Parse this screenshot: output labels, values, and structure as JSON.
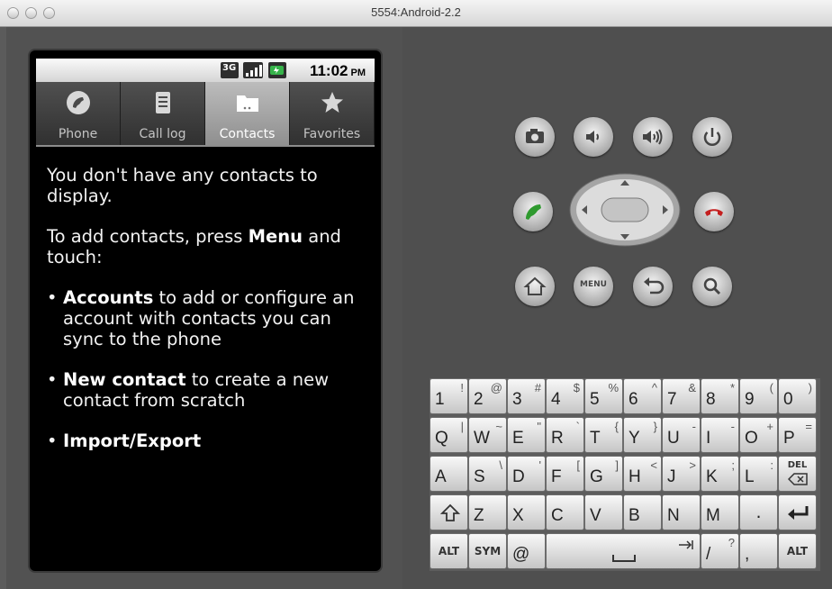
{
  "window": {
    "title": "5554:Android-2.2"
  },
  "statusbar": {
    "time": "11:02",
    "ampm": "PM",
    "network": "3G"
  },
  "tabs": [
    {
      "label": "Phone",
      "icon": "phone-icon",
      "selected": false
    },
    {
      "label": "Call log",
      "icon": "call-log-icon",
      "selected": false
    },
    {
      "label": "Contacts",
      "icon": "contacts-icon",
      "selected": true
    },
    {
      "label": "Favorites",
      "icon": "star-icon",
      "selected": false
    }
  ],
  "content": {
    "p1": "You don't have any contacts to display.",
    "p2_pre": "To add contacts, press ",
    "p2_bold": "Menu",
    "p2_post": " and touch:",
    "bullet1_bold": "Accounts",
    "bullet1_rest": " to add or configure an account with contacts you can sync to the phone",
    "bullet2_bold": "New contact",
    "bullet2_rest": " to create a new contact from scratch",
    "bullet3_bold": "Import/Export",
    "bullet_char": "•"
  },
  "controls": {
    "menu_label": "MENU"
  },
  "keyboard": {
    "row1": [
      {
        "main": "1",
        "alt": "!"
      },
      {
        "main": "2",
        "alt": "@"
      },
      {
        "main": "3",
        "alt": "#"
      },
      {
        "main": "4",
        "alt": "$"
      },
      {
        "main": "5",
        "alt": "%"
      },
      {
        "main": "6",
        "alt": "^"
      },
      {
        "main": "7",
        "alt": "&"
      },
      {
        "main": "8",
        "alt": "*"
      },
      {
        "main": "9",
        "alt": "("
      },
      {
        "main": "0",
        "alt": ")"
      }
    ],
    "row2": [
      {
        "main": "Q",
        "alt": "|"
      },
      {
        "main": "W",
        "alt": "~"
      },
      {
        "main": "E",
        "alt": "\""
      },
      {
        "main": "R",
        "alt": "`"
      },
      {
        "main": "T",
        "alt": "{"
      },
      {
        "main": "Y",
        "alt": "}"
      },
      {
        "main": "U",
        "alt": "-"
      },
      {
        "main": "I",
        "alt": "-"
      },
      {
        "main": "O",
        "alt": "+"
      },
      {
        "main": "P",
        "alt": "="
      }
    ],
    "row3": [
      {
        "main": "A",
        "alt": ""
      },
      {
        "main": "S",
        "alt": "\\"
      },
      {
        "main": "D",
        "alt": "'"
      },
      {
        "main": "F",
        "alt": "["
      },
      {
        "main": "G",
        "alt": "]"
      },
      {
        "main": "H",
        "alt": "<"
      },
      {
        "main": "J",
        "alt": ">"
      },
      {
        "main": "K",
        "alt": ";"
      },
      {
        "main": "L",
        "alt": ":"
      }
    ],
    "del_label": "DEL",
    "row4": [
      "Z",
      "X",
      "C",
      "V",
      "B",
      "N",
      "M",
      "."
    ],
    "alt_label": "ALT",
    "sym_label": "SYM",
    "at_label": "@",
    "slash_main": "/",
    "slash_alt": "?",
    "comma_label": ","
  }
}
